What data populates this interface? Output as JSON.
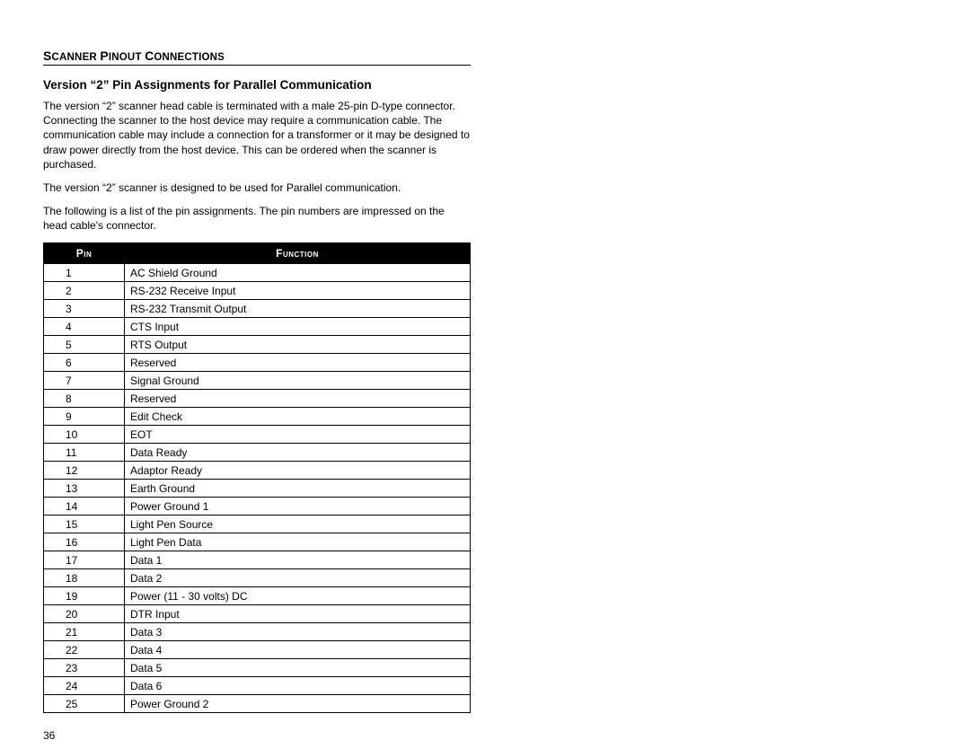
{
  "section_header_1": "S",
  "section_header_2": "CANNER ",
  "section_header_3": "P",
  "section_header_4": "INOUT ",
  "section_header_5": "C",
  "section_header_6": "ONNECTIONS",
  "subheading": "Version “2” Pin Assignments for Parallel Communication",
  "para1": "The version “2” scanner head cable is terminated with a male 25-pin D-type connector.  Connecting the scanner to the host device may require a communication cable.  The communication cable may include a connection for a transformer or it may be designed to draw power directly from the host device.  This can be ordered when the scanner is purchased.",
  "para2": "The version “2” scanner is designed to be used for Parallel communication.",
  "para3": "The following is a list of the pin assignments.  The pin numbers are impressed on the head cable's connector.",
  "table": {
    "headers": {
      "pin": "Pin",
      "function": "Function"
    },
    "rows": [
      {
        "pin": "1",
        "function": "AC Shield Ground"
      },
      {
        "pin": "2",
        "function": "RS-232 Receive Input"
      },
      {
        "pin": "3",
        "function": "RS-232 Transmit Output"
      },
      {
        "pin": "4",
        "function": "CTS Input"
      },
      {
        "pin": "5",
        "function": "RTS Output"
      },
      {
        "pin": "6",
        "function": "Reserved"
      },
      {
        "pin": "7",
        "function": "Signal Ground"
      },
      {
        "pin": "8",
        "function": "Reserved"
      },
      {
        "pin": "9",
        "function": "Edit Check"
      },
      {
        "pin": "10",
        "function": "EOT"
      },
      {
        "pin": "11",
        "function": "Data Ready"
      },
      {
        "pin": "12",
        "function": "Adaptor Ready"
      },
      {
        "pin": "13",
        "function": "Earth Ground"
      },
      {
        "pin": "14",
        "function": "Power Ground 1"
      },
      {
        "pin": "15",
        "function": "Light Pen Source"
      },
      {
        "pin": "16",
        "function": "Light Pen Data"
      },
      {
        "pin": "17",
        "function": "Data 1"
      },
      {
        "pin": "18",
        "function": "Data 2"
      },
      {
        "pin": "19",
        "function": "Power (11 - 30 volts) DC"
      },
      {
        "pin": "20",
        "function": "DTR Input"
      },
      {
        "pin": "21",
        "function": "Data 3"
      },
      {
        "pin": "22",
        "function": "Data 4"
      },
      {
        "pin": "23",
        "function": "Data 5"
      },
      {
        "pin": "24",
        "function": "Data 6"
      },
      {
        "pin": "25",
        "function": "Power Ground 2"
      }
    ]
  },
  "page_number": "36"
}
